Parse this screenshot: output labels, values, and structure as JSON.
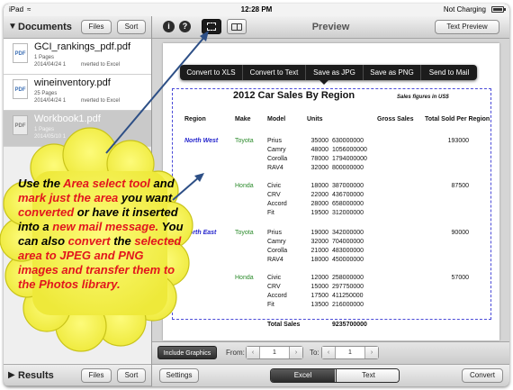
{
  "status_bar": {
    "device": "iPad",
    "time": "12:28 PM",
    "charging": "Not Charging"
  },
  "left_panel": {
    "header": {
      "title": "Documents",
      "files_button": "Files",
      "sort_button": "Sort"
    },
    "documents": [
      {
        "name": "GCI_rankings_pdf.pdf",
        "pages": "1 Pages",
        "date": "2014/04/24 1",
        "note": "nverted to Excel",
        "icon": "PDF"
      },
      {
        "name": "wineinventory.pdf",
        "pages": "25 Pages",
        "date": "2014/04/24 1",
        "note": "nverted to Excel",
        "icon": "PDF"
      },
      {
        "name": "Workbook1.pdf",
        "pages": "1 Pages",
        "date": "2014/05/10 1",
        "note": "",
        "icon": "PDF"
      }
    ],
    "footer": {
      "title": "Results",
      "files_button": "Files",
      "sort_button": "Sort"
    }
  },
  "right_panel": {
    "title": "Preview",
    "text_preview_button": "Text Preview",
    "info_icon": "i",
    "help_icon": "?",
    "context_menu": [
      "Convert to XLS",
      "Convert to Text",
      "Save as JPG",
      "Save as PNG",
      "Send to Mail"
    ],
    "sheet": {
      "title": "2012 Car Sales By Region",
      "note": "Sales figures in US$",
      "headers": [
        "Region",
        "Make",
        "Model",
        "Units",
        "Gross Sales",
        "Total Sold Per Region"
      ],
      "regions": [
        {
          "name": "North West",
          "total": "193000",
          "makes": [
            {
              "name": "Toyota",
              "rows": [
                [
                  "Prius",
                  "35000",
                  "630000000"
                ],
                [
                  "Camry",
                  "48000",
                  "1056000000"
                ],
                [
                  "Corolla",
                  "78000",
                  "1794000000"
                ],
                [
                  "RAV4",
                  "32000",
                  "800000000"
                ]
              ]
            },
            {
              "name": "Honda",
              "total": "87500",
              "rows": [
                [
                  "Civic",
                  "18000",
                  "387000000"
                ],
                [
                  "CRV",
                  "22000",
                  "436700000"
                ],
                [
                  "Accord",
                  "28000",
                  "658000000"
                ],
                [
                  "Fit",
                  "19500",
                  "312000000"
                ]
              ]
            }
          ]
        },
        {
          "name": "North East",
          "total": "90000",
          "makes": [
            {
              "name": "Toyota",
              "rows": [
                [
                  "Prius",
                  "19000",
                  "342000000"
                ],
                [
                  "Camry",
                  "32000",
                  "704000000"
                ],
                [
                  "Corolla",
                  "21000",
                  "483000000"
                ],
                [
                  "RAV4",
                  "18000",
                  "450000000"
                ]
              ]
            },
            {
              "name": "Honda",
              "total": "57000",
              "rows": [
                [
                  "Civic",
                  "12000",
                  "258000000"
                ],
                [
                  "CRV",
                  "15000",
                  "297750000"
                ],
                [
                  "Accord",
                  "17500",
                  "411250000"
                ],
                [
                  "Fit",
                  "13500",
                  "216000000"
                ]
              ]
            }
          ]
        }
      ],
      "total_label": "Total Sales",
      "total_value": "9235700000"
    },
    "range_bar": {
      "include_graphics": "Include Graphics",
      "from_label": "From:",
      "from_value": "1",
      "to_label": "To:",
      "to_value": "1"
    },
    "bottom_bar": {
      "settings": "Settings",
      "excel": "Excel",
      "text": "Text",
      "convert": "Convert"
    }
  },
  "callout": {
    "segments": [
      {
        "text": "Use the ",
        "red": false
      },
      {
        "text": "Area select tool",
        "red": true
      },
      {
        "text": " and ",
        "red": false
      },
      {
        "text": "mark just the area",
        "red": true
      },
      {
        "text": " you want ",
        "red": false
      },
      {
        "text": "converted",
        "red": true
      },
      {
        "text": " or have it inserted into a ",
        "red": false
      },
      {
        "text": "new mail message.",
        "red": true
      },
      {
        "text": " You can also ",
        "red": false
      },
      {
        "text": "convert",
        "red": true
      },
      {
        "text": " the ",
        "red": false
      },
      {
        "text": "selected area to JPEG and PNG images and transfer them to the Photos library.",
        "red": true
      }
    ]
  },
  "colors": {
    "callout_fill": "#f6f24a",
    "callout_stroke": "#c9c41a",
    "red_text": "#e2161d",
    "region_blue": "#2222cc",
    "make_green": "#2a8a2a"
  }
}
